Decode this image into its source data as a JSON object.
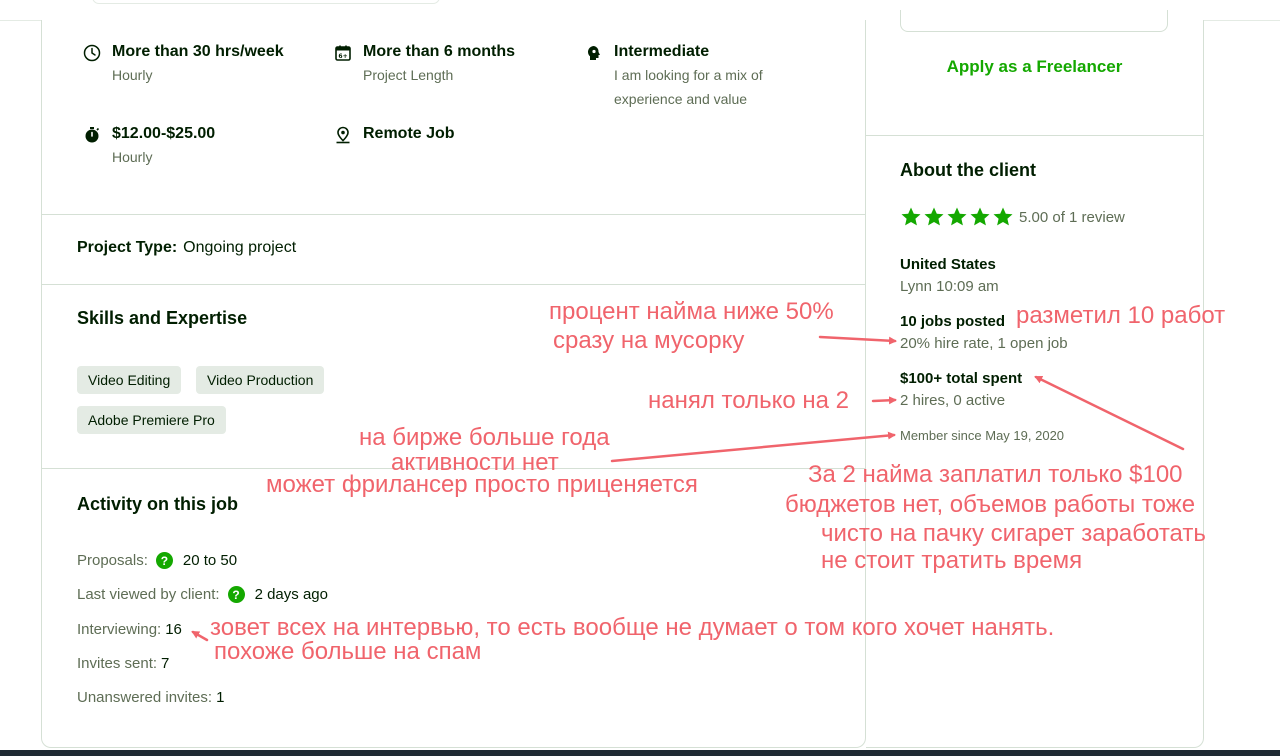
{
  "job_features": [
    {
      "icon": "clock-icon",
      "title": "More than 30 hrs/week",
      "subtitle": "Hourly"
    },
    {
      "icon": "calendar-icon",
      "title": "More than 6 months",
      "subtitle": "Project Length"
    },
    {
      "icon": "brain-icon",
      "title": "Intermediate",
      "subtitle_lines": [
        "I am looking for a mix of",
        "experience and value"
      ]
    },
    {
      "icon": "stopwatch-icon",
      "title": "$12.00-$25.00",
      "subtitle": "Hourly"
    },
    {
      "icon": "location-pin-icon",
      "title": "Remote Job"
    }
  ],
  "project_type": {
    "label": "Project Type:",
    "value": "Ongoing project"
  },
  "skills": {
    "title": "Skills and Expertise",
    "items": [
      "Video Editing",
      "Video Production",
      "Adobe Premiere Pro"
    ]
  },
  "activity": {
    "title": "Activity on this job",
    "proposals": {
      "label": "Proposals:",
      "value": "20 to 50"
    },
    "last_viewed": {
      "label": "Last viewed by client:",
      "value": "2 days ago"
    },
    "interviewing": {
      "label": "Interviewing:",
      "value": "16"
    },
    "invites_sent": {
      "label": "Invites sent:",
      "value": "7"
    },
    "unanswered": {
      "label": "Unanswered invites:",
      "value": "1"
    }
  },
  "sidebar": {
    "apply_label": "Apply as a Freelancer",
    "about_title": "About the client",
    "rating": {
      "value": 5.0,
      "stars": 5,
      "text": "5.00 of 1 review"
    },
    "country": "United States",
    "local_time": "Lynn 10:09 am",
    "jobs_posted": "10 jobs posted",
    "hire_rate": "20% hire rate, 1 open job",
    "total_spent": "$100+ total spent",
    "hires": "2 hires, 0 active",
    "member_since": "Member since May 19, 2020"
  },
  "annotations": {
    "hire_rate_note": [
      "процент найма ниже 50%",
      "сразу на мусорку"
    ],
    "jobs_note": "разметил 10 работ",
    "hired_note": "нанял только на 2",
    "member_note": [
      "на бирже больше года",
      "активности нет",
      "может фрилансер просто приценяется"
    ],
    "spent_note": [
      "За 2 найма заплатил только $100",
      "бюджетов нет, объемов работы тоже",
      "чисто на пачку сигарет заработать",
      "не стоит тратить время"
    ],
    "interview_note": [
      "зовет всех на интервью, то есть вообще не думает о том кого хочет нанять.",
      "похоже больше на спам"
    ]
  },
  "colors": {
    "accent_green": "#14a800",
    "annotation_red": "#f0646c",
    "muted_text": "#5e6d55",
    "chip_bg": "#e4ebe4"
  }
}
